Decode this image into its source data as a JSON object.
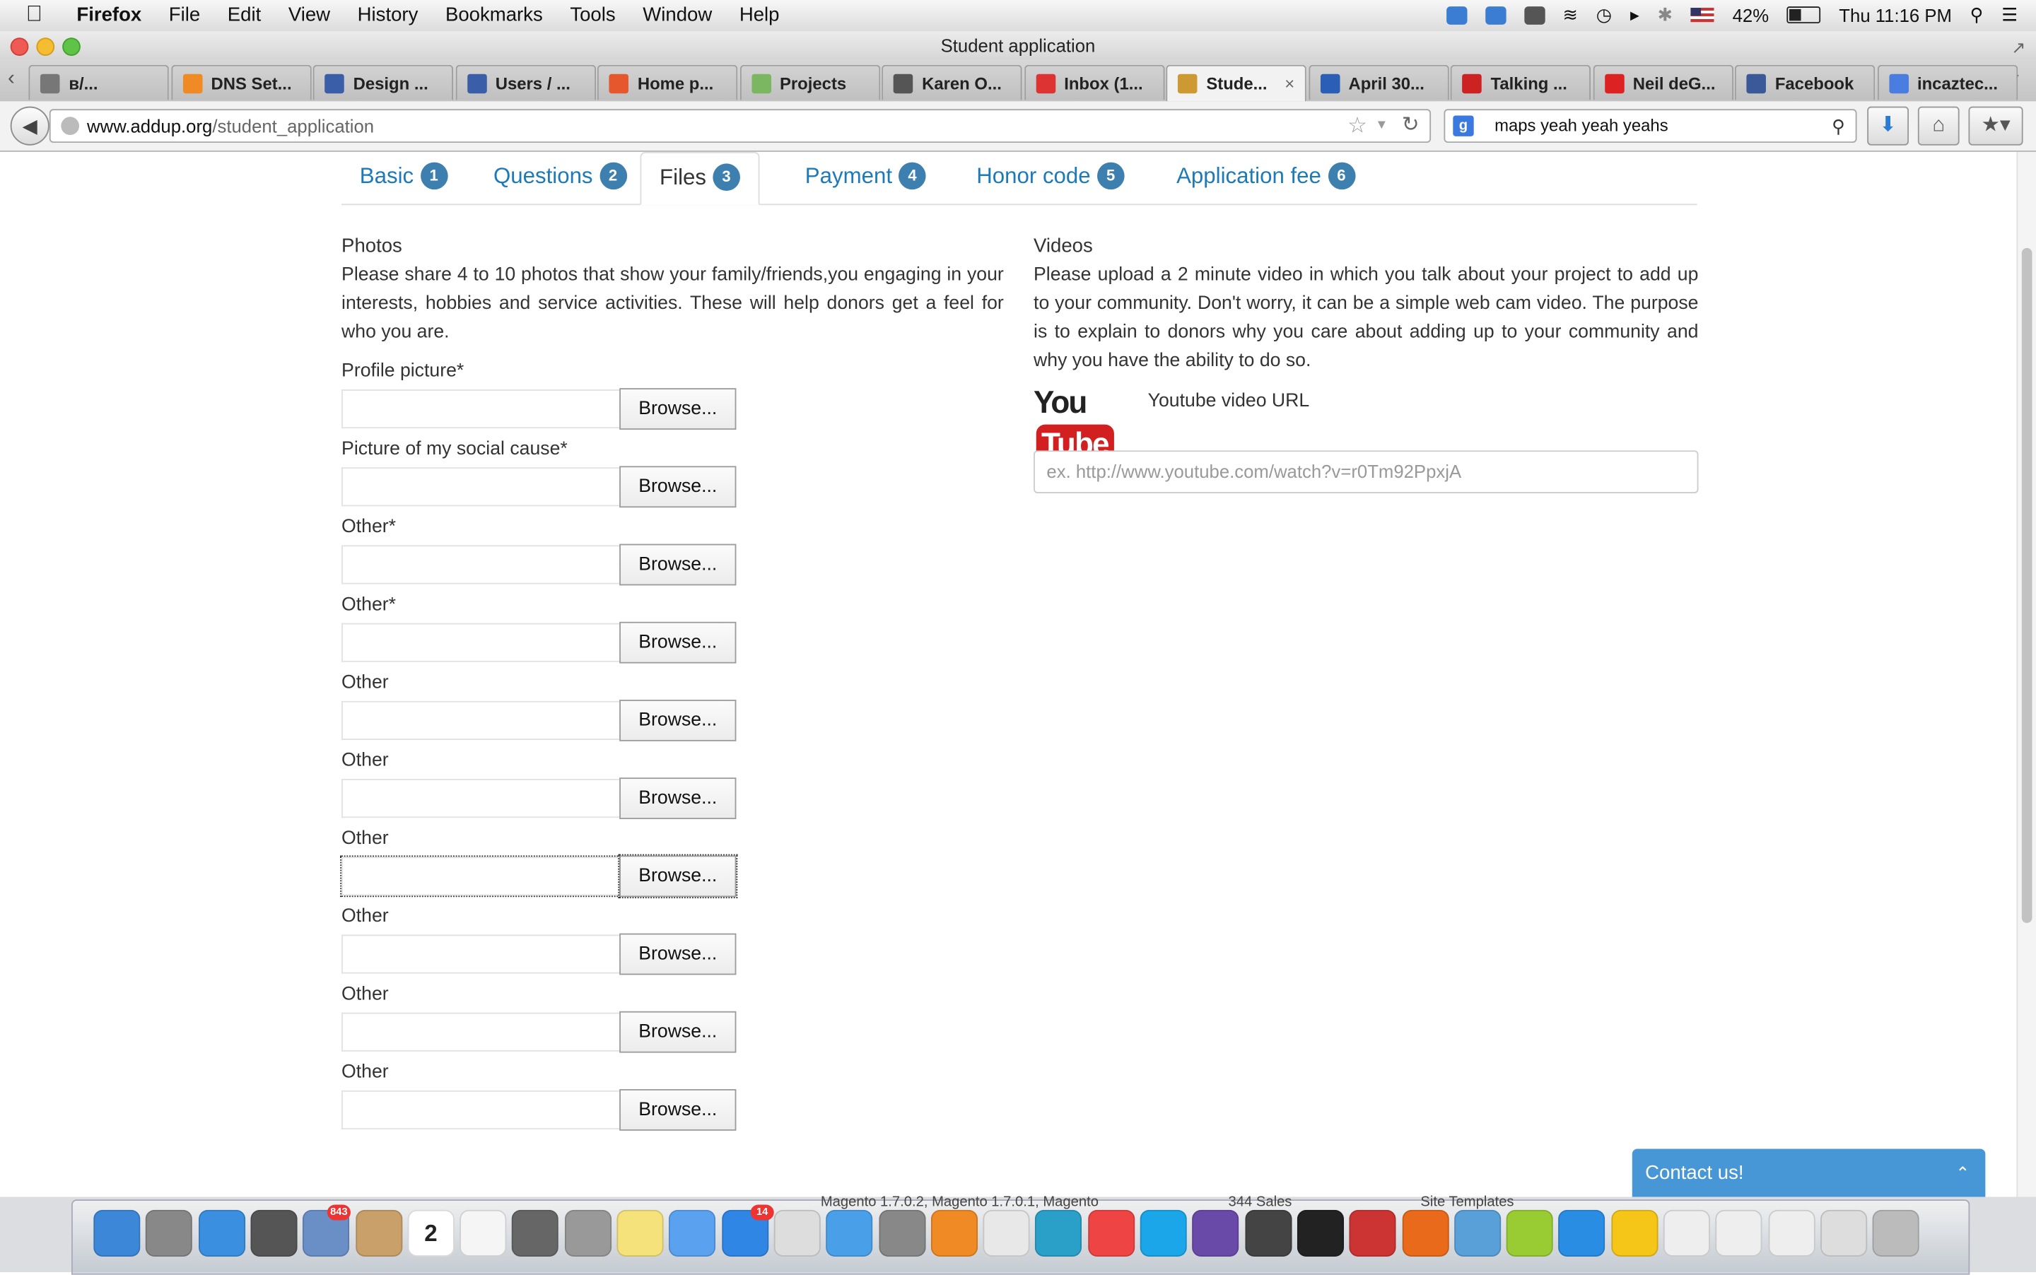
{
  "menubar": {
    "app_name": "Firefox",
    "menus": [
      "File",
      "Edit",
      "View",
      "History",
      "Bookmarks",
      "Tools",
      "Window",
      "Help"
    ],
    "battery": "42%",
    "clock": "Thu 11:16 PM"
  },
  "window": {
    "title": "Student application"
  },
  "tabs": [
    {
      "label": "в/...",
      "icon": "page-icon"
    },
    {
      "label": "DNS Set...",
      "icon": "cf-icon"
    },
    {
      "label": "Design ...",
      "icon": "grid-icon"
    },
    {
      "label": "Users / ...",
      "icon": "grid-icon"
    },
    {
      "label": "Home p...",
      "icon": "magento-icon"
    },
    {
      "label": "Projects",
      "icon": "cloud-icon"
    },
    {
      "label": "Karen O...",
      "icon": "wikipedia-icon"
    },
    {
      "label": "Inbox (1...",
      "icon": "gmail-icon"
    },
    {
      "label": "Stude...",
      "icon": "addup-icon",
      "active": true
    },
    {
      "label": "April 30...",
      "icon": "d-icon"
    },
    {
      "label": "Talking ...",
      "icon": "tpm-icon"
    },
    {
      "label": "Neil deG...",
      "icon": "youtube-icon"
    },
    {
      "label": "Facebook",
      "icon": "facebook-icon"
    },
    {
      "label": "incaztec...",
      "icon": "google-icon"
    }
  ],
  "navbar": {
    "url_domain": "www.addup.org",
    "url_path": "/student_application",
    "search_query": "maps yeah yeah yeahs"
  },
  "steps": [
    {
      "label": "Basic",
      "num": "1"
    },
    {
      "label": "Questions",
      "num": "2"
    },
    {
      "label": "Files",
      "num": "3",
      "active": true
    },
    {
      "label": "Payment",
      "num": "4"
    },
    {
      "label": "Honor code",
      "num": "5"
    },
    {
      "label": "Application fee",
      "num": "6"
    }
  ],
  "photos": {
    "heading": "Photos",
    "description": "Please share 4 to 10 photos that show your family/friends,you engaging in your interests, hobbies and service activities. These will help donors get a feel for who you are.",
    "fields": [
      {
        "label": "Profile picture*",
        "button": "Browse..."
      },
      {
        "label": "Picture of my social cause*",
        "button": "Browse..."
      },
      {
        "label": "Other*",
        "button": "Browse..."
      },
      {
        "label": "Other*",
        "button": "Browse..."
      },
      {
        "label": "Other",
        "button": "Browse..."
      },
      {
        "label": "Other",
        "button": "Browse..."
      },
      {
        "label": "Other",
        "button": "Browse...",
        "focused": true
      },
      {
        "label": "Other",
        "button": "Browse..."
      },
      {
        "label": "Other",
        "button": "Browse..."
      },
      {
        "label": "Other",
        "button": "Browse..."
      }
    ]
  },
  "videos": {
    "heading": "Videos",
    "description": "Please upload a 2 minute video in which you talk about your project to add up to your community. Don't worry, it can be a simple web cam video. The purpose is to explain to donors why you care about adding up to your community and why you have the ability to do so.",
    "youtube_logo_you": "You",
    "youtube_logo_tube": "Tube",
    "url_label": "Youtube video URL",
    "url_placeholder": "ex. http://www.youtube.com/watch?v=r0Tm92PpxjA"
  },
  "contact": {
    "label": "Contact us!"
  },
  "dock": {
    "background_text": [
      "Magento 1.7.0.2, Magento 1.7.0.1, Magento",
      "344 Sales",
      "Site Templates"
    ],
    "badges": [
      "843",
      "14"
    ],
    "calendar_day": "2",
    "items": [
      "finder",
      "launchpad",
      "safari",
      "photo-booth",
      "mail",
      "contacts",
      "calendar",
      "reminders",
      "facetime",
      "utilities",
      "stickies",
      "messages",
      "app-store",
      "trainer",
      "itunes",
      "system-preferences",
      "settings",
      "preview",
      "sourcetree",
      "chrome",
      "skype",
      "eclipse",
      "steam",
      "terminal",
      "filezilla",
      "firefox",
      "transmit",
      "android",
      "teamviewer",
      "cyberduck",
      "doc1",
      "doc2",
      "doc3",
      "doc4",
      "trash"
    ]
  },
  "colors": {
    "accent": "#1d7ab9",
    "badge": "#3d7fae",
    "contact": "#4797d6"
  }
}
